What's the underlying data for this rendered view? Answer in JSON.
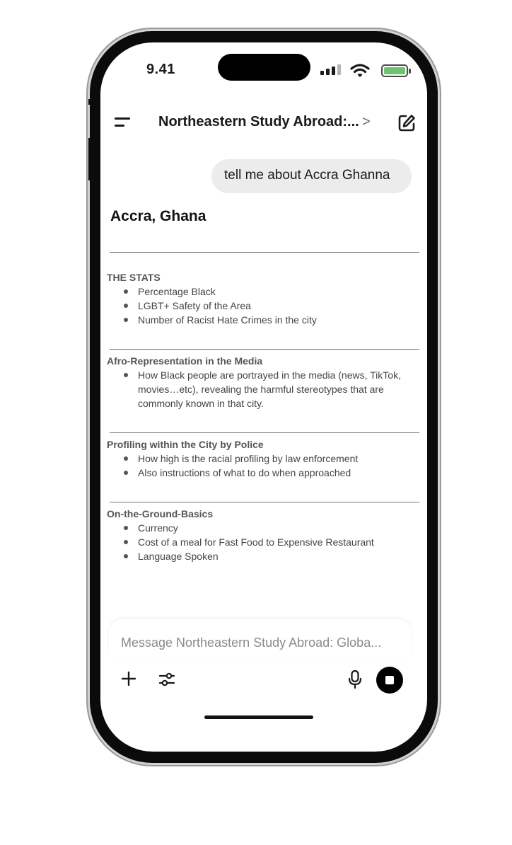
{
  "status_bar": {
    "time": "9.41"
  },
  "header": {
    "title": "Northeastern Study Abroad:...",
    "chevron": ">",
    "menu_icon": "hamburger-menu-icon",
    "edit_icon": "new-chat-edit-icon"
  },
  "chat": {
    "user_message": "tell me about Accra Ghanna",
    "response": {
      "heading": "Accra, Ghana",
      "sections": [
        {
          "title": "THE STATS",
          "items": [
            "Percentage Black",
            "LGBT+ Safety of the Area",
            "Number of Racist Hate Crimes in the city"
          ]
        },
        {
          "title": "Afro-Representation in the Media",
          "items": [
            "How Black people are portrayed in the media (news, TikTok, movies…etc), revealing the harmful stereotypes that are commonly known in that city."
          ]
        },
        {
          "title": "Profiling within the City by Police",
          "items": [
            "How high is the racial profiling by law enforcement",
            "Also instructions of what to do when approached"
          ]
        },
        {
          "title": "On-the-Ground-Basics",
          "items": [
            "Currency",
            "Cost of a meal for Fast Food to Expensive Restaurant",
            "Language Spoken"
          ]
        }
      ]
    }
  },
  "composer": {
    "placeholder": "Message Northeastern Study Abroad: Globa...",
    "icons": [
      "plus-icon",
      "tune-sliders-icon",
      "microphone-icon",
      "stop-icon"
    ]
  },
  "colors": {
    "bubble": "#ececec",
    "battery": "#6fc36f",
    "frame": "#0b0b0b"
  }
}
